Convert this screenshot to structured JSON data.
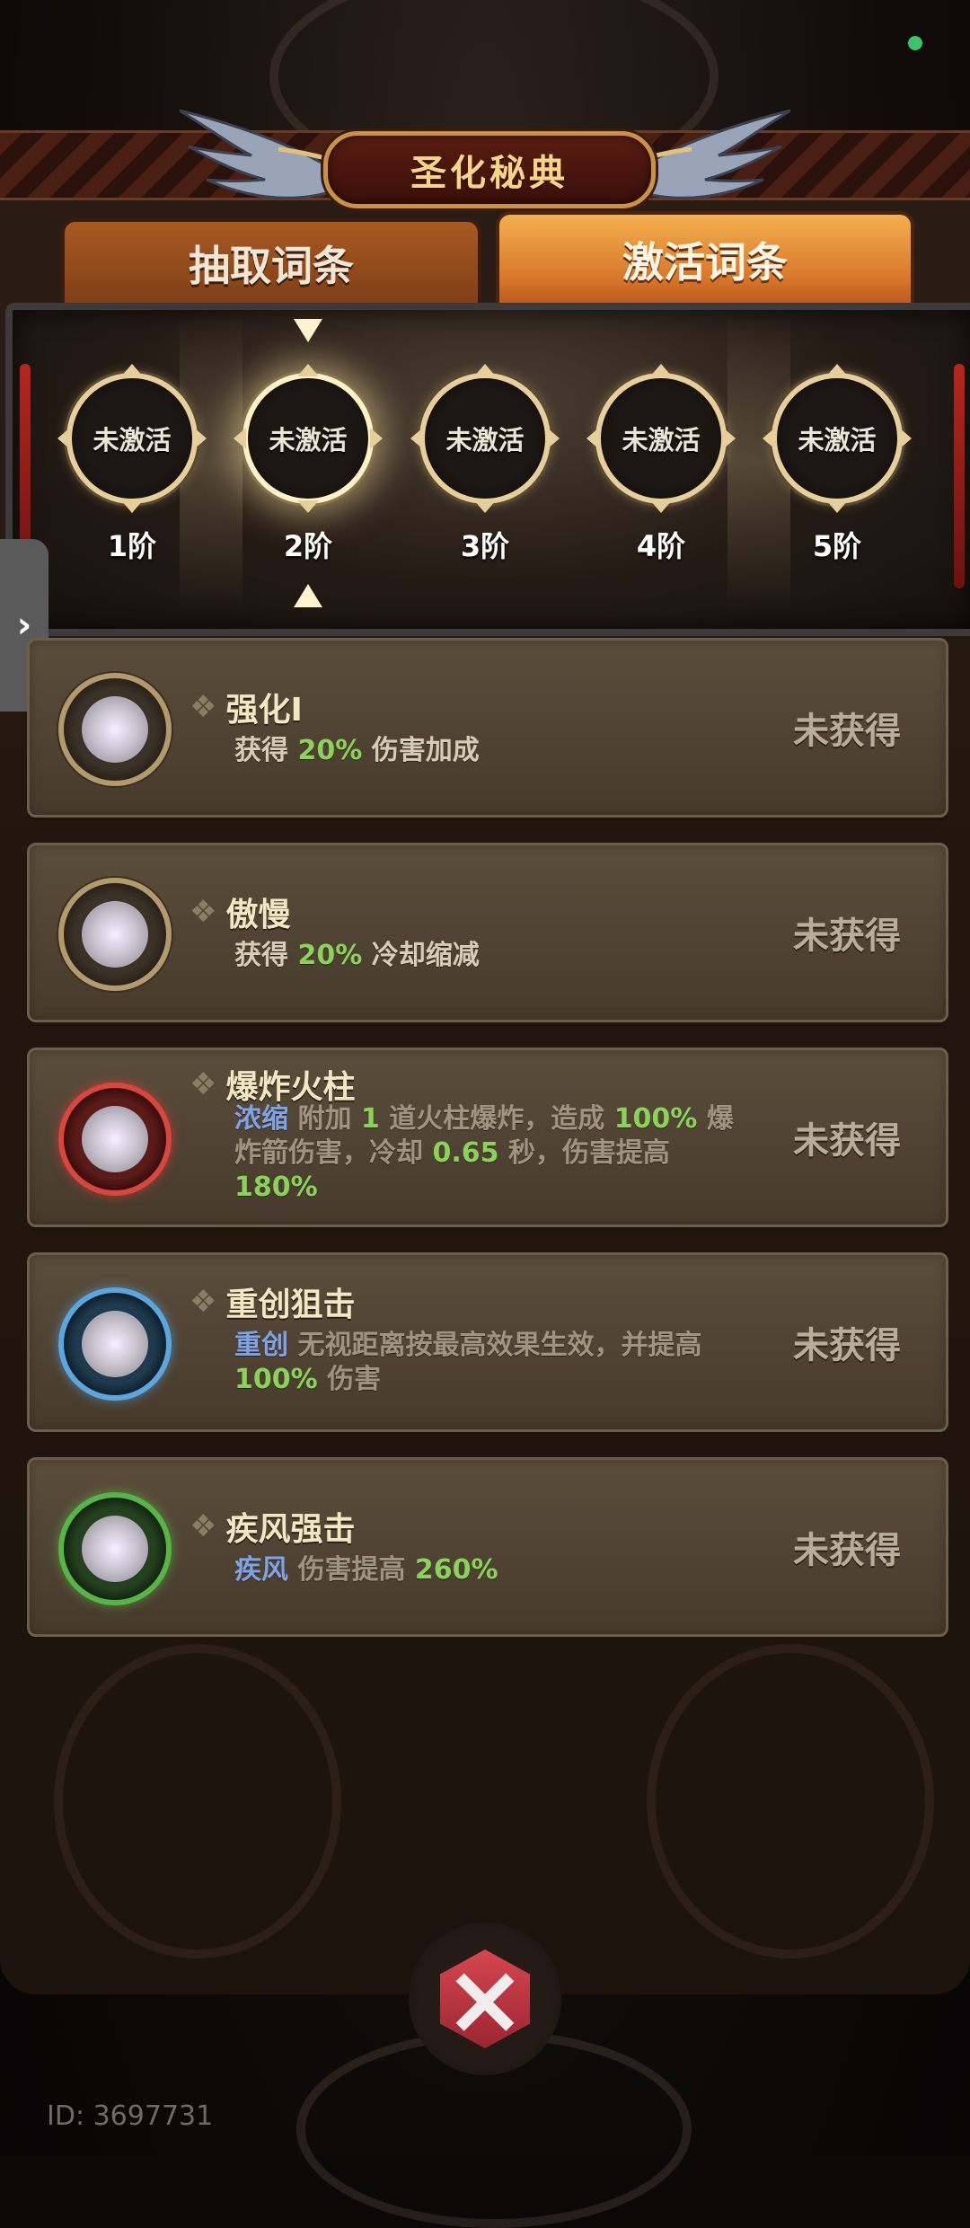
{
  "header": {
    "title": "圣化秘典"
  },
  "tabs": [
    {
      "label": "抽取词条",
      "active": false
    },
    {
      "label": "激活词条",
      "active": true
    }
  ],
  "tiers": [
    {
      "status": "未激活",
      "label": "1阶",
      "selected": false
    },
    {
      "status": "未激活",
      "label": "2阶",
      "selected": true
    },
    {
      "status": "未激活",
      "label": "3阶",
      "selected": false
    },
    {
      "status": "未激活",
      "label": "4阶",
      "selected": false
    },
    {
      "status": "未激活",
      "label": "5阶",
      "selected": false
    }
  ],
  "side_handle": {
    "icon": "chevron-right-icon",
    "glyph": "›"
  },
  "entries": [
    {
      "title": "强化I",
      "orb": "gold",
      "status": "未获得",
      "desc": {
        "pre": "获得",
        "value": "20%",
        "post": "伤害加成"
      }
    },
    {
      "title": "傲慢",
      "orb": "gold",
      "status": "未获得",
      "desc": {
        "pre": "获得",
        "value": "20%",
        "post": "冷却缩减"
      }
    },
    {
      "title": "爆炸火柱",
      "orb": "red",
      "status": "未获得",
      "desc": {
        "keyword": "浓缩",
        "t1": "附加",
        "n1": "1",
        "t2": "道火柱爆炸，造成",
        "n2": "100%",
        "t3": "爆炸箭伤害，冷却",
        "n3": "0.65",
        "t4": "秒，伤害提高",
        "n4": "180%"
      }
    },
    {
      "title": "重创狙击",
      "orb": "blue",
      "status": "未获得",
      "desc": {
        "keyword": "重创",
        "t1": "无视距离按最高效果生效，并提高",
        "n1": "100%",
        "t2": "伤害"
      }
    },
    {
      "title": "疾风强击",
      "orb": "green",
      "status": "未获得",
      "desc": {
        "keyword": "疾风",
        "t1": "伤害提高",
        "n1": "260%"
      }
    }
  ],
  "footer": {
    "id_text": "ID: 3697731"
  },
  "colors": {
    "accent": "#d9772a",
    "highlight_green": "#8bd25b",
    "keyword_blue": "#7ea3e6",
    "status_dot": "#3ec46d"
  }
}
